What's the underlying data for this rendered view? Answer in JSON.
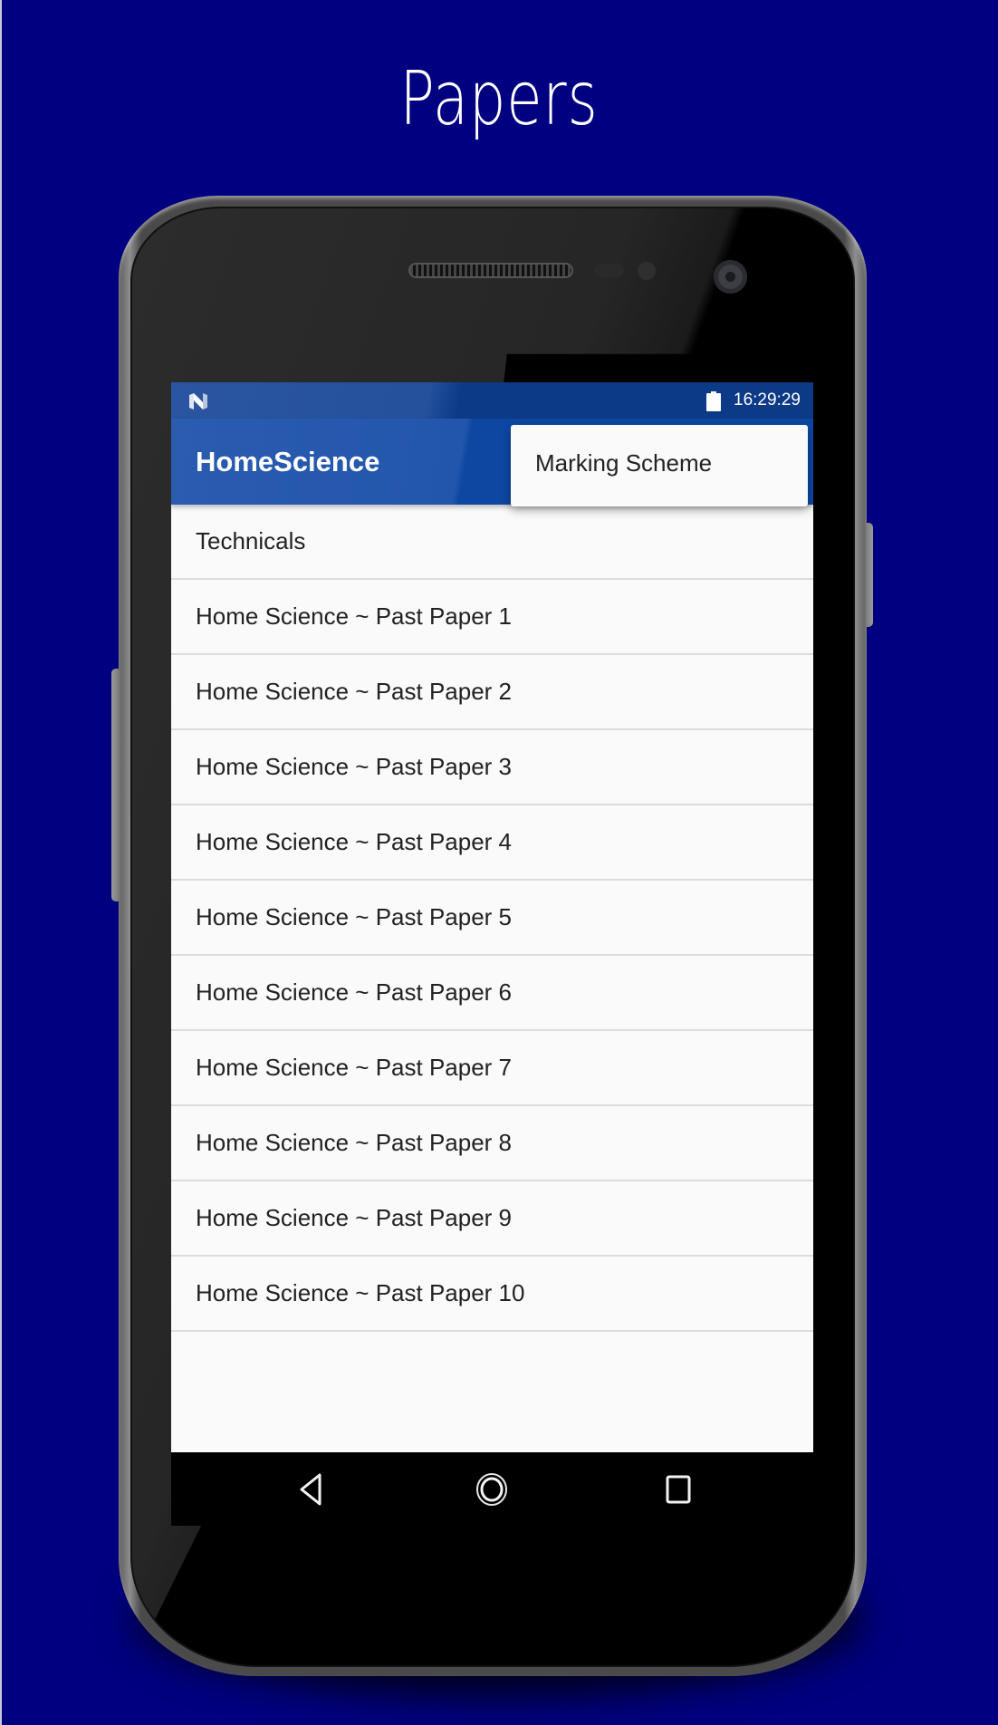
{
  "banner": {
    "title": "Papers"
  },
  "status_bar": {
    "left_icon": "android-n-icon",
    "battery_icon": "battery-full-icon",
    "time": "16:29:29"
  },
  "app_bar": {
    "title": "HomeScience"
  },
  "overflow_menu": {
    "items": [
      {
        "label": "Marking Scheme"
      }
    ]
  },
  "list": {
    "items": [
      {
        "label": "Technicals"
      },
      {
        "label": "Home Science ~ Past Paper 1"
      },
      {
        "label": "Home Science ~ Past Paper 2"
      },
      {
        "label": "Home Science ~ Past Paper 3"
      },
      {
        "label": "Home Science ~ Past Paper 4"
      },
      {
        "label": "Home Science ~ Past Paper 5"
      },
      {
        "label": "Home Science ~ Past Paper 6"
      },
      {
        "label": "Home Science ~ Past Paper 7"
      },
      {
        "label": "Home Science ~ Past Paper 8"
      },
      {
        "label": "Home Science ~ Past Paper 9"
      },
      {
        "label": "Home Science ~ Past Paper 10"
      }
    ]
  },
  "nav_bar": {
    "buttons": [
      {
        "icon": "back-triangle-icon"
      },
      {
        "icon": "home-circle-icon"
      },
      {
        "icon": "recent-apps-square-icon"
      }
    ]
  },
  "colors": {
    "background": "#000080",
    "app_bar": "#0d47a1",
    "status_bar": "#0c3a86",
    "list_background": "#fafafa",
    "text": "#222222"
  }
}
